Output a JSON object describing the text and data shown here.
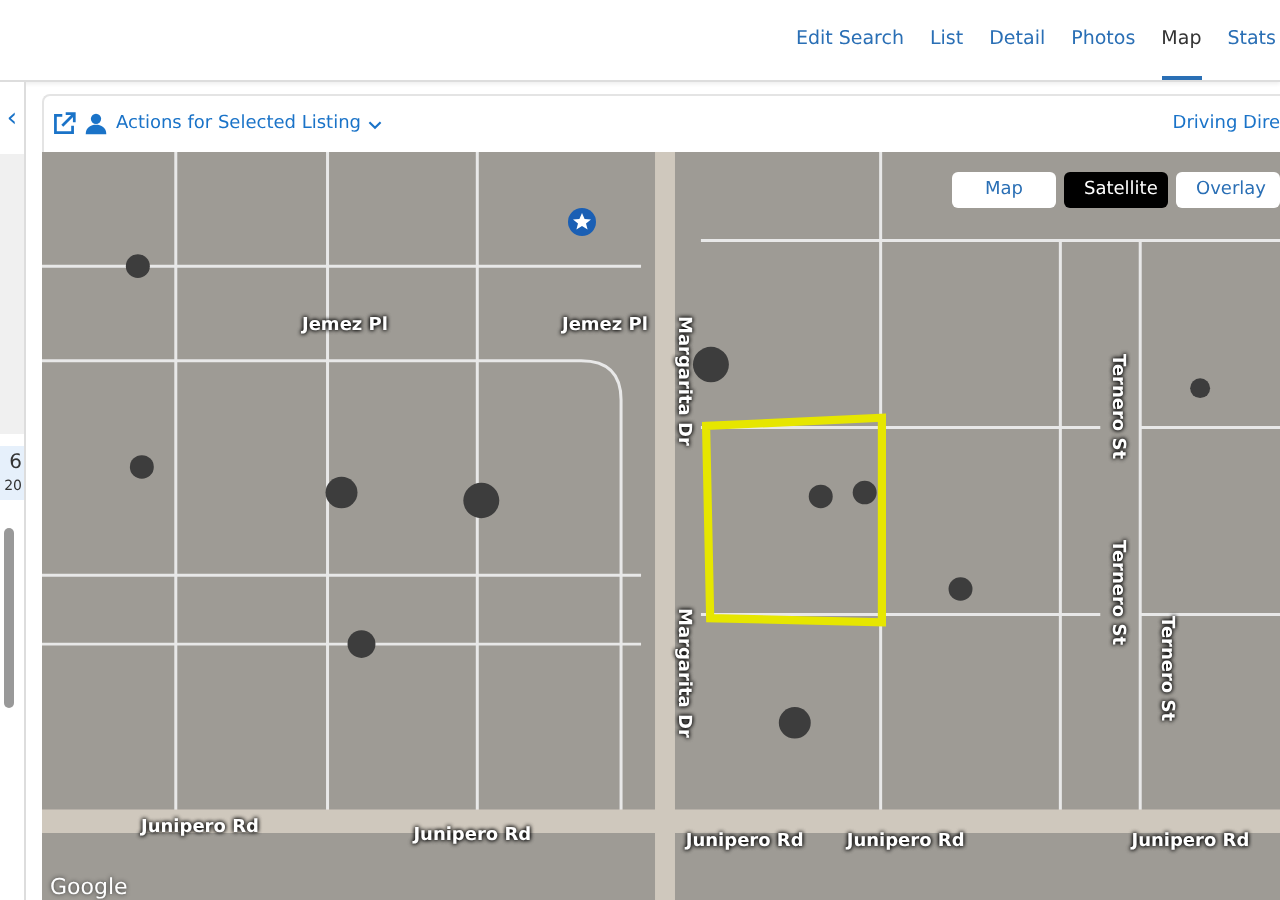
{
  "nav": {
    "tabs": [
      {
        "label": "Edit Search",
        "selected": false
      },
      {
        "label": "List",
        "selected": false
      },
      {
        "label": "Detail",
        "selected": false
      },
      {
        "label": "Photos",
        "selected": false
      },
      {
        "label": "Map",
        "selected": true
      },
      {
        "label": "Stats",
        "selected": false
      }
    ]
  },
  "side_panel": {
    "collapse": "‹",
    "count": "6",
    "count_sub": "20"
  },
  "toolbar": {
    "actions": "Actions for Selected Listing",
    "link": "Driving Dire"
  },
  "map": {
    "types": [
      {
        "label": "Map",
        "selected": false
      },
      {
        "label": "Satellite",
        "selected": true
      },
      {
        "label": "Overlay",
        "selected": false
      }
    ],
    "streets": [
      {
        "label": "Jemez Pl",
        "kind": "horizontal"
      },
      {
        "label": "Jemez Pl",
        "kind": "horizontal"
      },
      {
        "label": "Margarita Dr",
        "kind": "vertical"
      },
      {
        "label": "Margarita Dr",
        "kind": "vertical"
      },
      {
        "label": "Ternero St",
        "kind": "vertical"
      },
      {
        "label": "Ternero St",
        "kind": "vertical"
      },
      {
        "label": "Ternero St",
        "kind": "vertical"
      },
      {
        "label": "Junipero Rd",
        "kind": "horizontal"
      },
      {
        "label": "Junipero Rd",
        "kind": "horizontal"
      },
      {
        "label": "Junipero Rd",
        "kind": "horizontal"
      },
      {
        "label": "Junipero Rd",
        "kind": "horizontal"
      },
      {
        "label": "Junipero Rd",
        "kind": "horizontal"
      }
    ],
    "attribution": "Google"
  }
}
